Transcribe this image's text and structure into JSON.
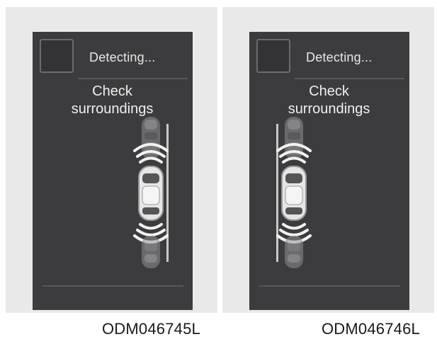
{
  "panels": [
    {
      "status": "Detecting...",
      "message_line1": "Check",
      "message_line2": "surroundings",
      "caption": "ODM046745L"
    },
    {
      "status": "Detecting...",
      "message_line1": "Check",
      "message_line2": "surroundings",
      "caption": "ODM046746L"
    }
  ],
  "icons": {
    "status": "blank-square-icon",
    "vehicle": "car-top-view-icon",
    "sensor": "sensor-wave-icon"
  },
  "colors": {
    "screen": "#3c3c3e",
    "panel": "#e9e9e9",
    "text": "#efefef"
  }
}
